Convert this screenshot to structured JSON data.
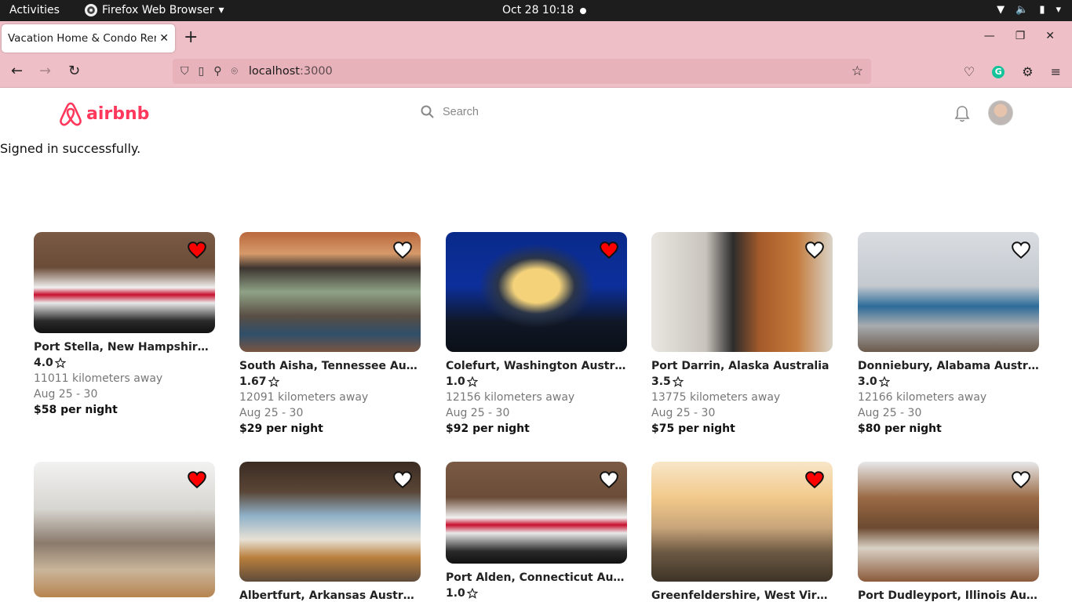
{
  "os": {
    "activities": "Activities",
    "app_name": "Firefox Web Browser",
    "clock": "Oct 28  10:18"
  },
  "browser": {
    "tab_title": "Vacation Home & Condo Rentals",
    "url_host": "localhost",
    "url_port": ":3000"
  },
  "header": {
    "logo_text": "airbnb",
    "search_placeholder": "Search",
    "brand_color": "#ff385c"
  },
  "flash": "Signed in successfully.",
  "listings": [
    {
      "location": "Port Stella, New Hampshire Australia",
      "rating": "4.0",
      "distance": "11011 kilometers away",
      "dates": "Aug 25 - 30",
      "price": "$58 per night",
      "favorited": true,
      "photo": "bedroom-brick"
    },
    {
      "location": "South Aisha, Tennessee Australia",
      "rating": "1.67",
      "distance": "12091 kilometers away",
      "dates": "Aug 25 - 30",
      "price": "$29 per night",
      "favorited": false,
      "photo": "living-wood"
    },
    {
      "location": "Colefurt, Washington Australia",
      "rating": "1.0",
      "distance": "12156 kilometers away",
      "dates": "Aug 25 - 30",
      "price": "$92 per night",
      "favorited": true,
      "photo": "house-night"
    },
    {
      "location": "Port Darrin, Alaska Australia",
      "rating": "3.5",
      "distance": "13775 kilometers away",
      "dates": "Aug 25 - 30",
      "price": "$75 per night",
      "favorited": false,
      "photo": "people-door"
    },
    {
      "location": "Donniebury, Alabama Australia",
      "rating": "3.0",
      "distance": "12166 kilometers away",
      "dates": "Aug 25 - 30",
      "price": "$80 per night",
      "favorited": false,
      "photo": "living-grey"
    },
    {
      "location": "",
      "rating": "",
      "distance": "",
      "dates": "",
      "price": "",
      "favorited": true,
      "photo": "loft"
    },
    {
      "location": "Albertfurt, Arkansas Australia",
      "rating": "",
      "distance": "",
      "dates": "",
      "price": "",
      "favorited": false,
      "photo": "bed-canopy"
    },
    {
      "location": "Port Alden, Connecticut Australia",
      "rating": "1.0",
      "distance": "",
      "dates": "",
      "price": "",
      "favorited": false,
      "photo": "bedroom-brick"
    },
    {
      "location": "Greenfeldershire, West Virginia Australia",
      "rating": "",
      "distance": "",
      "dates": "",
      "price": "",
      "favorited": true,
      "photo": "airstream"
    },
    {
      "location": "Port Dudleyport, Illinois Australia",
      "rating": "",
      "distance": "",
      "dates": "",
      "price": "",
      "favorited": false,
      "photo": "bedroom-wood"
    }
  ]
}
